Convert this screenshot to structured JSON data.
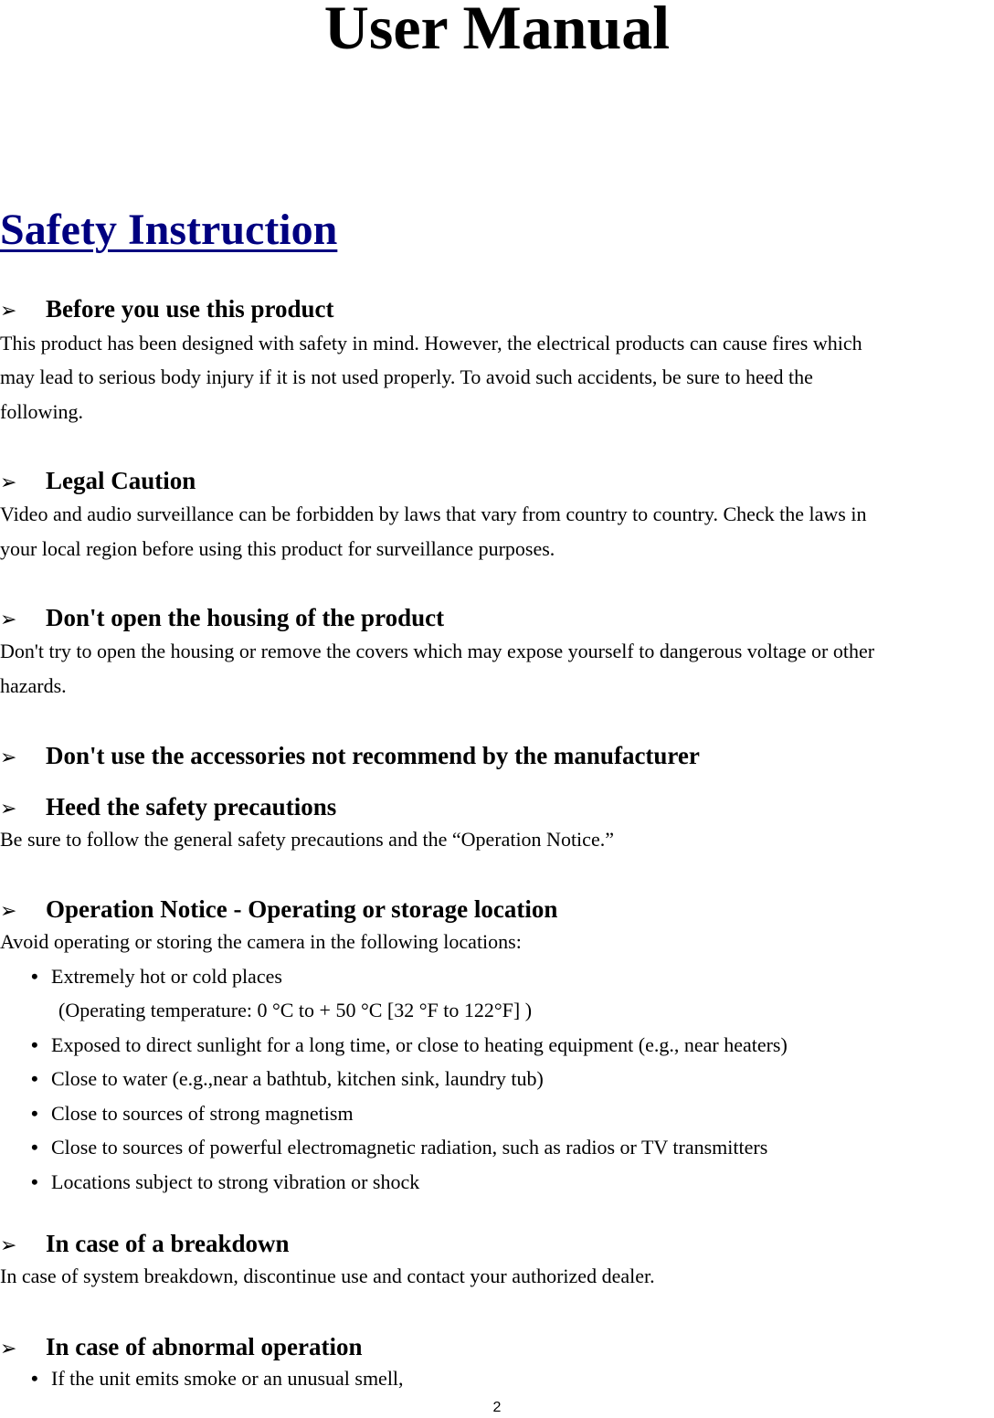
{
  "document": {
    "title": "User Manual",
    "section_title": "Safety Instruction",
    "page_number": "2",
    "arrow_glyph": "➢",
    "bullet_glyph": "•",
    "accent_color": "#000080"
  },
  "sections": [
    {
      "heading": "Before you use this product",
      "body": [
        "This product has been designed with safety in mind. However, the electrical products can cause fires which",
        "may lead to serious body injury if it is not used properly. To avoid such accidents, be sure to heed the",
        "following."
      ]
    },
    {
      "heading": "Legal Caution",
      "body": [
        "Video and audio surveillance can be forbidden by laws that vary from country to country. Check the laws in",
        "your local region before using this product for surveillance purposes."
      ]
    },
    {
      "heading": "Don't open the housing of the product",
      "body": [
        "Don't try to open the housing or remove the covers which may expose yourself to dangerous voltage or other",
        "hazards."
      ]
    },
    {
      "heading": "Don't use the accessories not recommend by the manufacturer",
      "body": []
    },
    {
      "heading": "Heed the safety precautions",
      "body": [
        "Be sure to follow the general safety precautions and the “Operation Notice.”"
      ]
    },
    {
      "heading": "Operation Notice - Operating or storage location",
      "body": [
        "Avoid operating or storing the camera in the following locations:"
      ],
      "bullets": [
        "Extremely hot or cold places",
        "Exposed to direct sunlight for a long time, or close to heating equipment (e.g., near heaters)",
        "Close to water (e.g.,near a bathtub, kitchen sink, laundry tub)",
        "Close to sources of strong magnetism",
        "Close to sources of powerful electromagnetic radiation, such as radios or TV transmitters",
        "Locations subject to strong vibration or shock"
      ],
      "bullet_note": "(Operating temperature: 0 °C to + 50 °C [32 °F to 122°F] )"
    },
    {
      "heading": "In case of a breakdown",
      "body": [
        "In case of system breakdown, discontinue use and contact your authorized dealer."
      ]
    },
    {
      "heading": "In case of abnormal operation",
      "bullets": [
        "If the unit emits smoke or an unusual smell,"
      ]
    }
  ]
}
